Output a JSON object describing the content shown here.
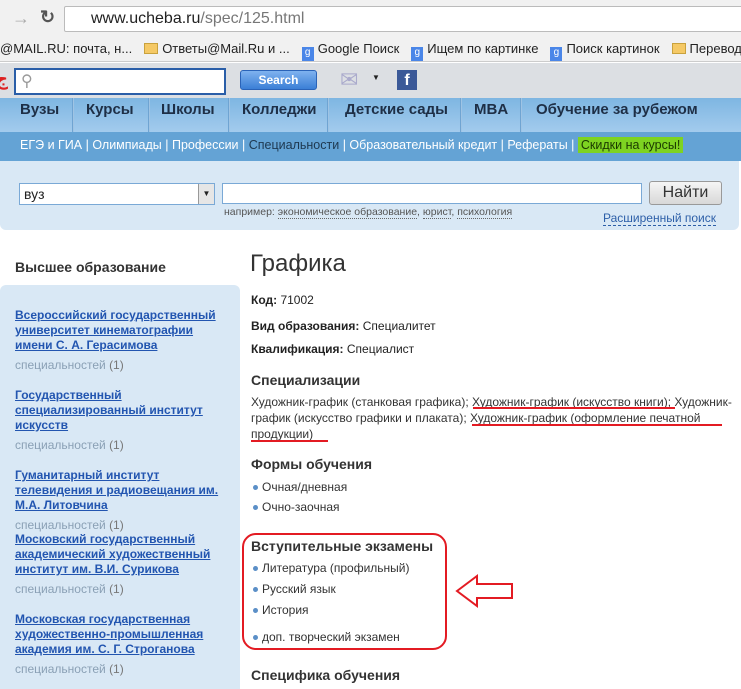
{
  "browser": {
    "url_host": "www.ucheba.ru",
    "url_path": "/spec/125.html"
  },
  "bookmarks": [
    {
      "label": "@MAIL.RU: почта, н...",
      "icon": "none"
    },
    {
      "label": "Ответы@Mail.Ru и ...",
      "icon": "folder-icon"
    },
    {
      "label": "Google Поиск",
      "icon": "google-icon"
    },
    {
      "label": "Ищем по картинке",
      "icon": "google-icon"
    },
    {
      "label": "Поиск картинок",
      "icon": "google-icon"
    },
    {
      "label": "Перевод. Сло",
      "icon": "folder-icon"
    }
  ],
  "toolbar": {
    "search_button": "Search"
  },
  "nav": [
    "Вузы",
    "Курсы",
    "Школы",
    "Колледжи",
    "Детские сады",
    "MBA",
    "Обучение за рубежом"
  ],
  "subnav": {
    "items": [
      "ЕГЭ и ГИА",
      "Олимпиады",
      "Профессии",
      "Специальности",
      "Образовательный кредит",
      "Рефераты"
    ],
    "current": "Специальности",
    "promo": "Скидки на курсы!"
  },
  "search": {
    "select_value": "вуз",
    "find_button": "Найти",
    "hint_prefix": "например:",
    "hints": [
      "экономическое образование",
      "юрист",
      "психология"
    ],
    "advanced": "Расширенный поиск"
  },
  "sidebar": {
    "title": "Высшее образование",
    "count_label": "специальностей",
    "items": [
      {
        "name": "Всероссийский государственный университет кинематографии имени С. А. Герасимова",
        "count": "(1)"
      },
      {
        "name": "Государственный специализированный институт искусств",
        "count": "(1)"
      },
      {
        "name": "Гуманитарный институт телевидения и радиовещания им. М.А. Литовчина",
        "count": "(1)"
      },
      {
        "name": "Московский государственный академический художественный институт им. В.И. Сурикова",
        "count": "(1)"
      },
      {
        "name": "Московская государственная художественно-промышленная академия им. С. Г. Строганова",
        "count": "(1)"
      }
    ]
  },
  "main": {
    "title": "Графика",
    "fields": [
      {
        "label": "Код:",
        "value": "71002"
      },
      {
        "label": "Вид образования:",
        "value": "Специалитет"
      },
      {
        "label": "Квалификация:",
        "value": "Специалист"
      }
    ],
    "spec_title": "Специализации",
    "spec_text": "Художник-график (станковая графика); Художник-график (искусство книги); Художник-график (искусство графики и плаката); Художник-график (оформление печатной продукции)",
    "forms_title": "Формы обучения",
    "forms": [
      "Очная/дневная",
      "Очно-заочная"
    ],
    "exams_title": "Вступительные экзамены",
    "exams": [
      "Литература (профильный)",
      "Русский язык",
      "История",
      "доп. творческий экзамен"
    ],
    "specifics_title": "Специфика обучения"
  },
  "colors": {
    "annotation": "#e31b23",
    "link": "#2255b0",
    "nav": "#7eb6e2"
  }
}
